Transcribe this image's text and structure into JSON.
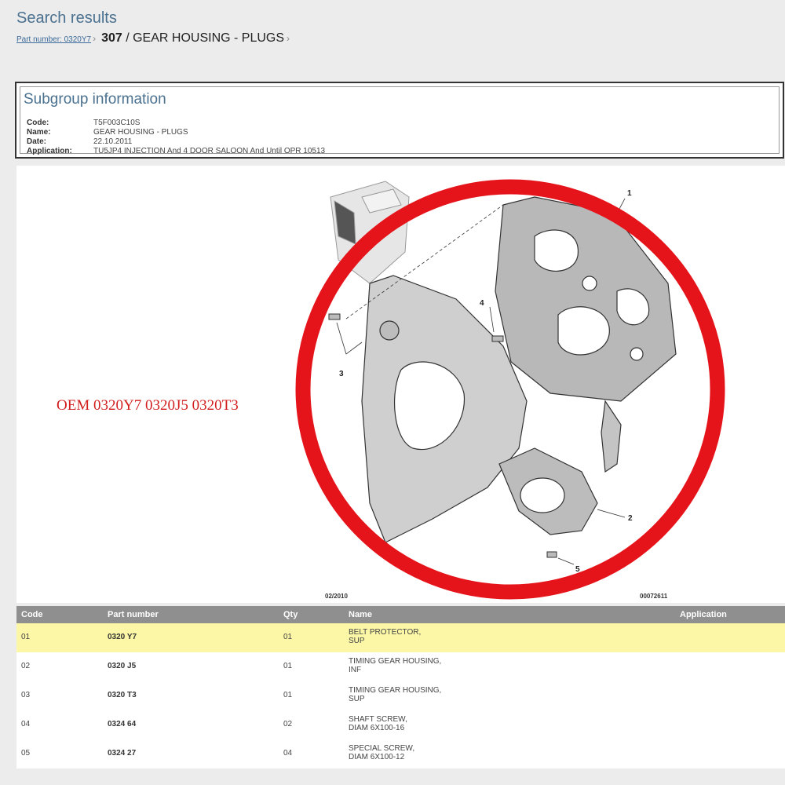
{
  "header": {
    "title": "Search results",
    "breadcrumb_link": "Part number: 0320Y7",
    "breadcrumb_sep": "›",
    "breadcrumb_code": "307",
    "breadcrumb_rest": " / GEAR HOUSING - PLUGS",
    "breadcrumb_end": "›"
  },
  "subgroup": {
    "title": "Subgroup information",
    "fields": [
      {
        "key": "Code:",
        "value": "T5F003C10S"
      },
      {
        "key": "Name:",
        "value": "GEAR HOUSING - PLUGS"
      },
      {
        "key": "Date:",
        "value": "22.10.2011"
      },
      {
        "key": "Application:",
        "value": "TU5JP4 INJECTION And 4 DOOR SALOON And Until OPR 10513"
      }
    ]
  },
  "figure": {
    "oem_text": "OEM 0320Y7 0320J5 0320T3",
    "date_code": "02/2010",
    "drawing_number": "00072611",
    "callouts": [
      "1",
      "2",
      "3",
      "4",
      "5"
    ],
    "highlight_color": "#e5141b"
  },
  "table": {
    "headers": {
      "code": "Code",
      "part_number": "Part number",
      "qty": "Qty",
      "name": "Name",
      "application": "Application"
    },
    "rows": [
      {
        "code": "01",
        "part_number": "0320 Y7",
        "qty": "01",
        "name1": "BELT PROTECTOR,",
        "name2": "SUP",
        "selected": true
      },
      {
        "code": "02",
        "part_number": "0320 J5",
        "qty": "01",
        "name1": "TIMING GEAR HOUSING,",
        "name2": "INF",
        "selected": false
      },
      {
        "code": "03",
        "part_number": "0320 T3",
        "qty": "01",
        "name1": "TIMING GEAR HOUSING,",
        "name2": "SUP",
        "selected": false
      },
      {
        "code": "04",
        "part_number": "0324 64",
        "qty": "02",
        "name1": "SHAFT SCREW,",
        "name2": "DIAM 6X100-16",
        "selected": false
      },
      {
        "code": "05",
        "part_number": "0324 27",
        "qty": "04",
        "name1": "SPECIAL SCREW,",
        "name2": "DIAM 6X100-12",
        "selected": false
      }
    ]
  }
}
